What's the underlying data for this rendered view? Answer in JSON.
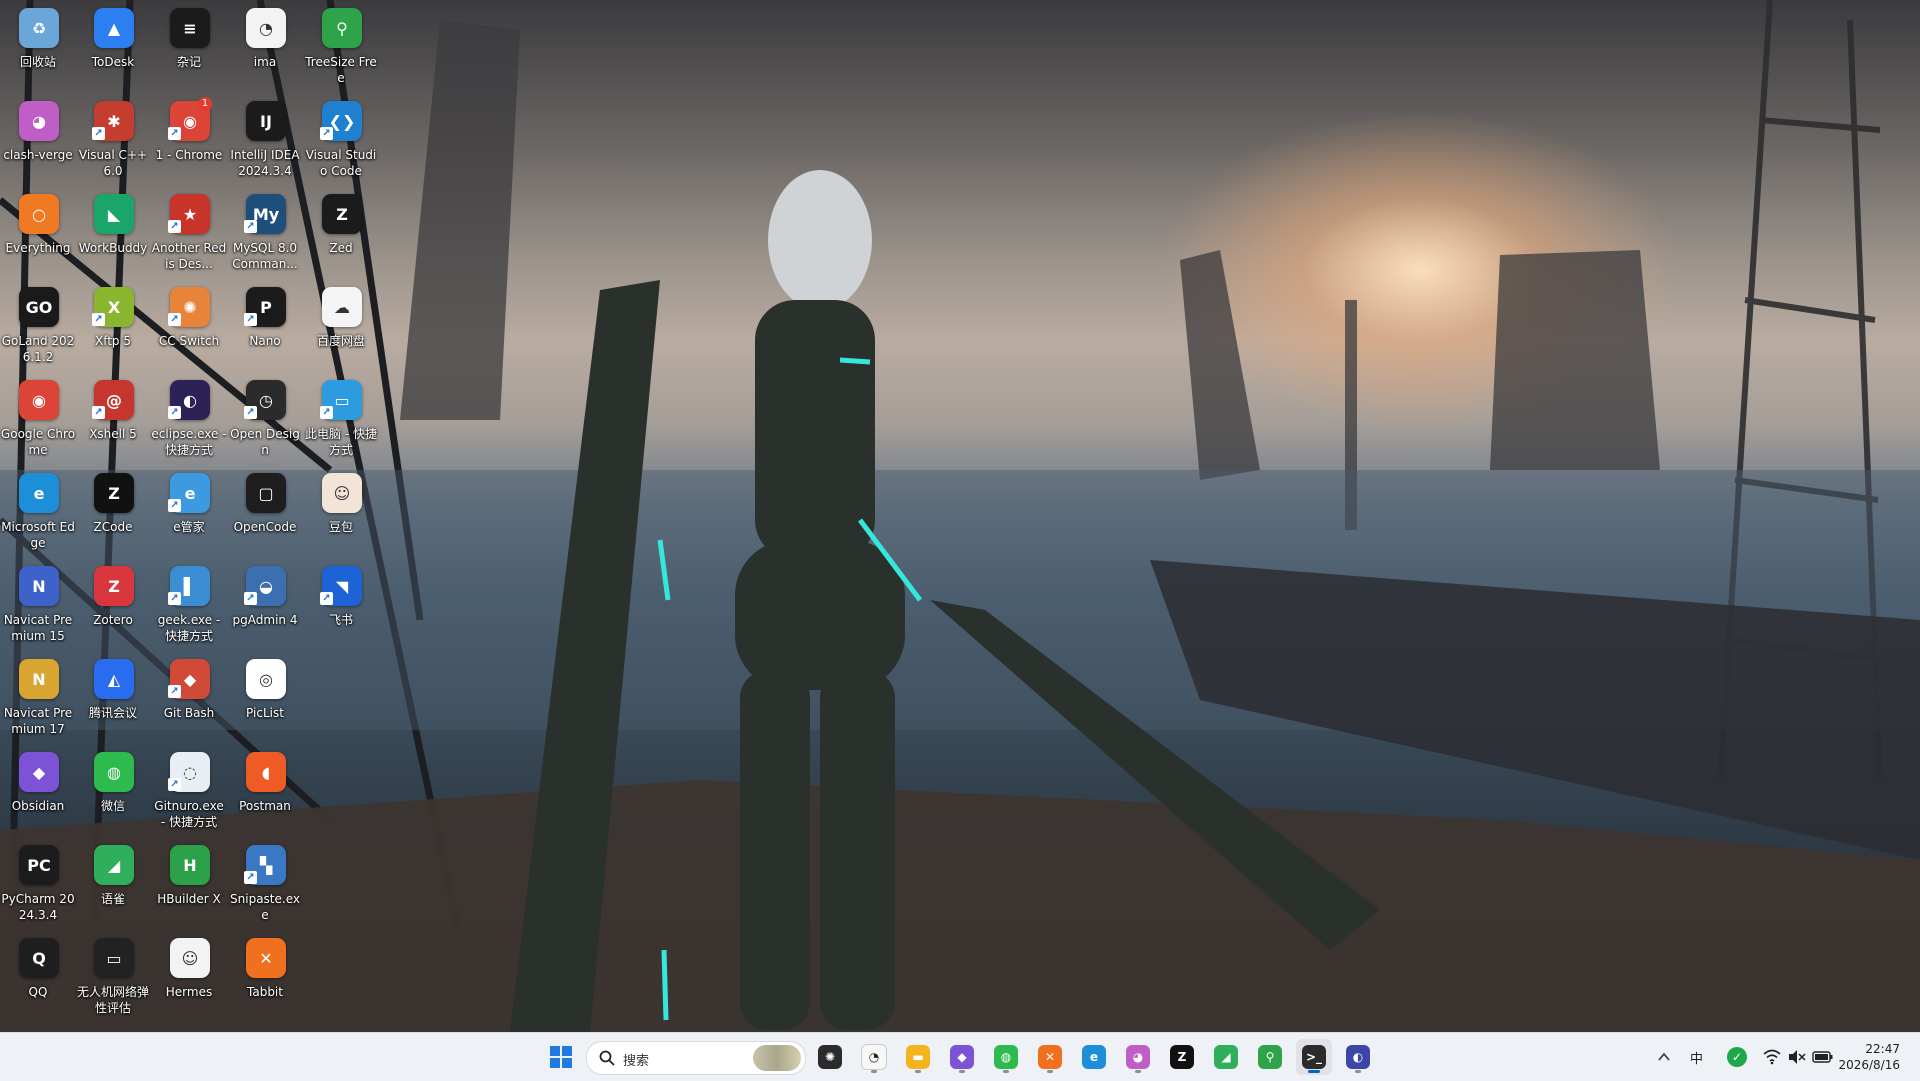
{
  "desktop": {
    "icons": [
      {
        "label": "回收站",
        "icon": "recycle-bin-icon",
        "color": "#6aa7d8",
        "glyph": "♻",
        "shortcut": false
      },
      {
        "label": "clash-verge",
        "icon": "cat-icon",
        "color": "#c05ec8",
        "glyph": "◕",
        "shortcut": false
      },
      {
        "label": "Everything",
        "icon": "search-ring-icon",
        "color": "#f07a24",
        "glyph": "○",
        "shortcut": false
      },
      {
        "label": "GoLand 2026.1.2",
        "icon": "goland-icon",
        "color": "#1a1a1a",
        "glyph": "GO",
        "shortcut": false
      },
      {
        "label": "Google Chrome",
        "icon": "chrome-icon",
        "color": "#db4437",
        "glyph": "◉",
        "shortcut": false
      },
      {
        "label": "Microsoft Edge",
        "icon": "edge-icon",
        "color": "#1c8fd8",
        "glyph": "e",
        "shortcut": false
      },
      {
        "label": "Navicat Premium 15",
        "icon": "navicat-icon",
        "color": "#3d62c9",
        "glyph": "N",
        "shortcut": false
      },
      {
        "label": "Navicat Premium 17",
        "icon": "navicat-17-icon",
        "color": "#d9a531",
        "glyph": "N",
        "shortcut": false
      },
      {
        "label": "Obsidian",
        "icon": "obsidian-icon",
        "color": "#7c53d6",
        "glyph": "◆",
        "shortcut": false
      },
      {
        "label": "PyCharm 2024.3.4",
        "icon": "pycharm-icon",
        "color": "#1c1c1c",
        "glyph": "PC",
        "shortcut": false
      },
      {
        "label": "QQ",
        "icon": "qq-penguin-icon",
        "color": "#1e1e1e",
        "glyph": "Q",
        "shortcut": false
      },
      {
        "label": "ToDesk",
        "icon": "todesk-icon",
        "color": "#2b7ff0",
        "glyph": "▲",
        "shortcut": false
      },
      {
        "label": "Visual C++ 6.0",
        "icon": "visual-cpp-icon",
        "color": "#c43d2e",
        "glyph": "✱",
        "shortcut": true
      },
      {
        "label": "WorkBuddy",
        "icon": "workbuddy-icon",
        "color": "#1aa66a",
        "glyph": "◣",
        "shortcut": false
      },
      {
        "label": "Xftp 5",
        "icon": "xftp-icon",
        "color": "#8ab52e",
        "glyph": "X",
        "shortcut": true
      },
      {
        "label": "Xshell 5",
        "icon": "xshell-icon",
        "color": "#c5372e",
        "glyph": "@",
        "shortcut": true
      },
      {
        "label": "ZCode",
        "icon": "zcode-icon",
        "color": "#111111",
        "glyph": "Z",
        "shortcut": false
      },
      {
        "label": "Zotero",
        "icon": "zotero-icon",
        "color": "#d9363e",
        "glyph": "Z",
        "shortcut": false
      },
      {
        "label": "腾讯会议",
        "icon": "tencent-meeting-icon",
        "color": "#2a6cf0",
        "glyph": "◭",
        "shortcut": false
      },
      {
        "label": "微信",
        "icon": "wechat-icon",
        "color": "#2dbb4e",
        "glyph": "◍",
        "shortcut": false
      },
      {
        "label": "语雀",
        "icon": "yuque-icon",
        "color": "#2fae5c",
        "glyph": "◢",
        "shortcut": false
      },
      {
        "label": "无人机网络弹性评估",
        "icon": "monitor-icon",
        "color": "#222222",
        "glyph": "▭",
        "shortcut": false
      },
      {
        "label": "杂记",
        "icon": "notes-icon",
        "color": "#1b1b1b",
        "glyph": "≡",
        "shortcut": false
      },
      {
        "label": "1 - Chrome",
        "icon": "chrome-badge-icon",
        "color": "#db4437",
        "glyph": "◉",
        "shortcut": true,
        "badge": "1"
      },
      {
        "label": "Another Redis Des...",
        "icon": "redis-icon",
        "color": "#c8332a",
        "glyph": "★",
        "shortcut": true
      },
      {
        "label": "CC Switch",
        "icon": "cc-switch-icon",
        "color": "#e8833a",
        "glyph": "✺",
        "shortcut": true
      },
      {
        "label": "eclipse.exe - 快捷方式",
        "icon": "eclipse-icon",
        "color": "#2c2255",
        "glyph": "◐",
        "shortcut": true
      },
      {
        "label": "e管家",
        "icon": "e-manager-icon",
        "color": "#3c9be0",
        "glyph": "e",
        "shortcut": true
      },
      {
        "label": "geek.exe - 快捷方式",
        "icon": "geek-icon",
        "color": "#3b8ed3",
        "glyph": "▌",
        "shortcut": true
      },
      {
        "label": "Git Bash",
        "icon": "git-bash-icon",
        "color": "#d14a38",
        "glyph": "◆",
        "shortcut": true
      },
      {
        "label": "Gitnuro.exe - 快捷方式",
        "icon": "gitnuro-icon",
        "color": "#e9eef4",
        "glyph": "◌",
        "shortcut": true
      },
      {
        "label": "HBuilder X",
        "icon": "hbuilder-icon",
        "color": "#2ba14a",
        "glyph": "H",
        "shortcut": false
      },
      {
        "label": "Hermes",
        "icon": "hermes-icon",
        "color": "#f3f3f3",
        "glyph": "☺",
        "shortcut": false
      },
      {
        "label": "ima",
        "icon": "panda-icon",
        "color": "#f3f3f3",
        "glyph": "◔",
        "shortcut": false
      },
      {
        "label": "IntelliJ IDEA 2024.3.4",
        "icon": "intellij-icon",
        "color": "#1b1b1b",
        "glyph": "IJ",
        "shortcut": false
      },
      {
        "label": "MySQL 8.0 Comman...",
        "icon": "mysql-icon",
        "color": "#1e4f7a",
        "glyph": "My",
        "shortcut": true
      },
      {
        "label": "Nano",
        "icon": "nano-icon",
        "color": "#1b1b1b",
        "glyph": "P",
        "shortcut": true
      },
      {
        "label": "Open Design",
        "icon": "open-design-icon",
        "color": "#2b2b2b",
        "glyph": "◷",
        "shortcut": true
      },
      {
        "label": "OpenCode",
        "icon": "opencode-icon",
        "color": "#1e1e1e",
        "glyph": "▢",
        "shortcut": false
      },
      {
        "label": "pgAdmin 4",
        "icon": "pgadmin-elephant-icon",
        "color": "#3c6fb0",
        "glyph": "◒",
        "shortcut": true
      },
      {
        "label": "PicList",
        "icon": "piclist-icon",
        "color": "#ffffff",
        "glyph": "◎",
        "shortcut": false
      },
      {
        "label": "Postman",
        "icon": "postman-icon",
        "color": "#ef5b25",
        "glyph": "◖",
        "shortcut": false
      },
      {
        "label": "Snipaste.exe",
        "icon": "snipaste-icon",
        "color": "#3a78c4",
        "glyph": "▚",
        "shortcut": true
      },
      {
        "label": "Tabbit",
        "icon": "tabbit-icon",
        "color": "#f07020",
        "glyph": "✕",
        "shortcut": false
      },
      {
        "label": "TreeSize Free",
        "icon": "treesize-icon",
        "color": "#2fa34a",
        "glyph": "⚲",
        "shortcut": false
      },
      {
        "label": "Visual Studio Code",
        "icon": "vscode-icon",
        "color": "#1f80cf",
        "glyph": "❮❯",
        "shortcut": true
      },
      {
        "label": "Zed",
        "icon": "zed-icon",
        "color": "#1b1b1b",
        "glyph": "Z",
        "shortcut": false
      },
      {
        "label": "百度网盘",
        "icon": "baidu-netdisk-icon",
        "color": "#f5f5f5",
        "glyph": "☁",
        "shortcut": false
      },
      {
        "label": "此电脑 - 快捷方式",
        "icon": "this-pc-icon",
        "color": "#2d9be0",
        "glyph": "▭",
        "shortcut": true
      },
      {
        "label": "豆包",
        "icon": "doubao-icon",
        "color": "#f2e4d6",
        "glyph": "☺",
        "shortcut": false
      },
      {
        "label": "飞书",
        "icon": "feishu-icon",
        "color": "#1d63d6",
        "glyph": "◥",
        "shortcut": true
      }
    ]
  },
  "taskbar": {
    "start": {
      "icon": "windows-start-icon"
    },
    "search": {
      "placeholder": "搜索",
      "icon": "search-icon"
    },
    "pinned": [
      {
        "name": "chatgpt",
        "icon": "chatgpt-icon",
        "color": "#2b2b2b",
        "glyph": "✺",
        "state": "none"
      },
      {
        "name": "ima",
        "icon": "panda-icon",
        "color": "#f7f7f7",
        "glyph": "◔",
        "state": "running"
      },
      {
        "name": "file-explorer",
        "icon": "folder-icon",
        "color": "#f2b520",
        "glyph": "▬",
        "state": "running"
      },
      {
        "name": "obsidian",
        "icon": "obsidian-icon",
        "color": "#7c53d6",
        "glyph": "◆",
        "state": "running"
      },
      {
        "name": "wechat",
        "icon": "wechat-icon",
        "color": "#2dbb4e",
        "glyph": "◍",
        "state": "running"
      },
      {
        "name": "tabbit",
        "icon": "tabbit-icon",
        "color": "#f07020",
        "glyph": "✕",
        "state": "running"
      },
      {
        "name": "edge",
        "icon": "edge-icon",
        "color": "#1c8fd8",
        "glyph": "e",
        "state": "none"
      },
      {
        "name": "clash-verge",
        "icon": "cat-icon",
        "color": "#c05ec8",
        "glyph": "◕",
        "state": "running"
      },
      {
        "name": "zcode",
        "icon": "zcode-icon",
        "color": "#111111",
        "glyph": "Z",
        "state": "none"
      },
      {
        "name": "yuque",
        "icon": "yuque-icon",
        "color": "#2fae5c",
        "glyph": "◢",
        "state": "none"
      },
      {
        "name": "treesize",
        "icon": "treesize-icon",
        "color": "#2fa34a",
        "glyph": "⚲",
        "state": "none"
      },
      {
        "name": "terminal",
        "icon": "terminal-icon",
        "color": "#2b2b2b",
        "glyph": ">_",
        "state": "active"
      },
      {
        "name": "snipping",
        "icon": "snipping-tool-icon",
        "color": "#3b46a8",
        "glyph": "◐",
        "state": "running"
      }
    ],
    "tray": {
      "overflow_icon": "chevron-up-icon",
      "ime": "中",
      "wifi_icon": "wifi-icon",
      "volume_icon": "volume-muted-icon",
      "battery_icon": "battery-icon",
      "time": "22:47",
      "date": "2026/8/16"
    }
  }
}
